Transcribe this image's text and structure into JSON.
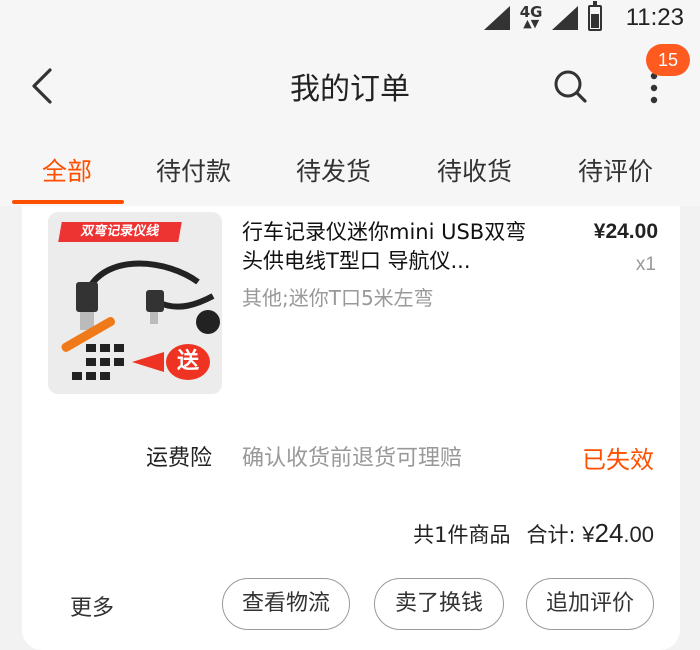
{
  "status_bar": {
    "network": "4G",
    "time": "11:23"
  },
  "header": {
    "title": "我的订单",
    "notification_count": "15"
  },
  "tabs": [
    {
      "label": "全部",
      "active": true
    },
    {
      "label": "待付款",
      "active": false
    },
    {
      "label": "待发货",
      "active": false
    },
    {
      "label": "待收货",
      "active": false
    },
    {
      "label": "待评价",
      "active": false
    }
  ],
  "order": {
    "product": {
      "image_banner": "双弯记录仪线",
      "image_badge": "送",
      "title": "行车记录仪迷你mini USB双弯头供电线T型口 导航仪...",
      "sku": "其他;迷你T口5米左弯",
      "price": "¥24.00",
      "quantity": "x1"
    },
    "insurance": {
      "label": "运费险",
      "description": "确认收货前退货可理赔",
      "status": "已失效"
    },
    "summary": {
      "count_text": "共1件商品",
      "total_label": "合计:",
      "total_currency": "¥",
      "total_int": "24",
      "total_dec": ".00"
    },
    "actions": {
      "more": "更多",
      "logistics": "查看物流",
      "sold_exchange": "卖了换钱",
      "review": "追加评价"
    }
  },
  "colors": {
    "accent": "#ff5000",
    "badge": "#ff5a1f"
  }
}
